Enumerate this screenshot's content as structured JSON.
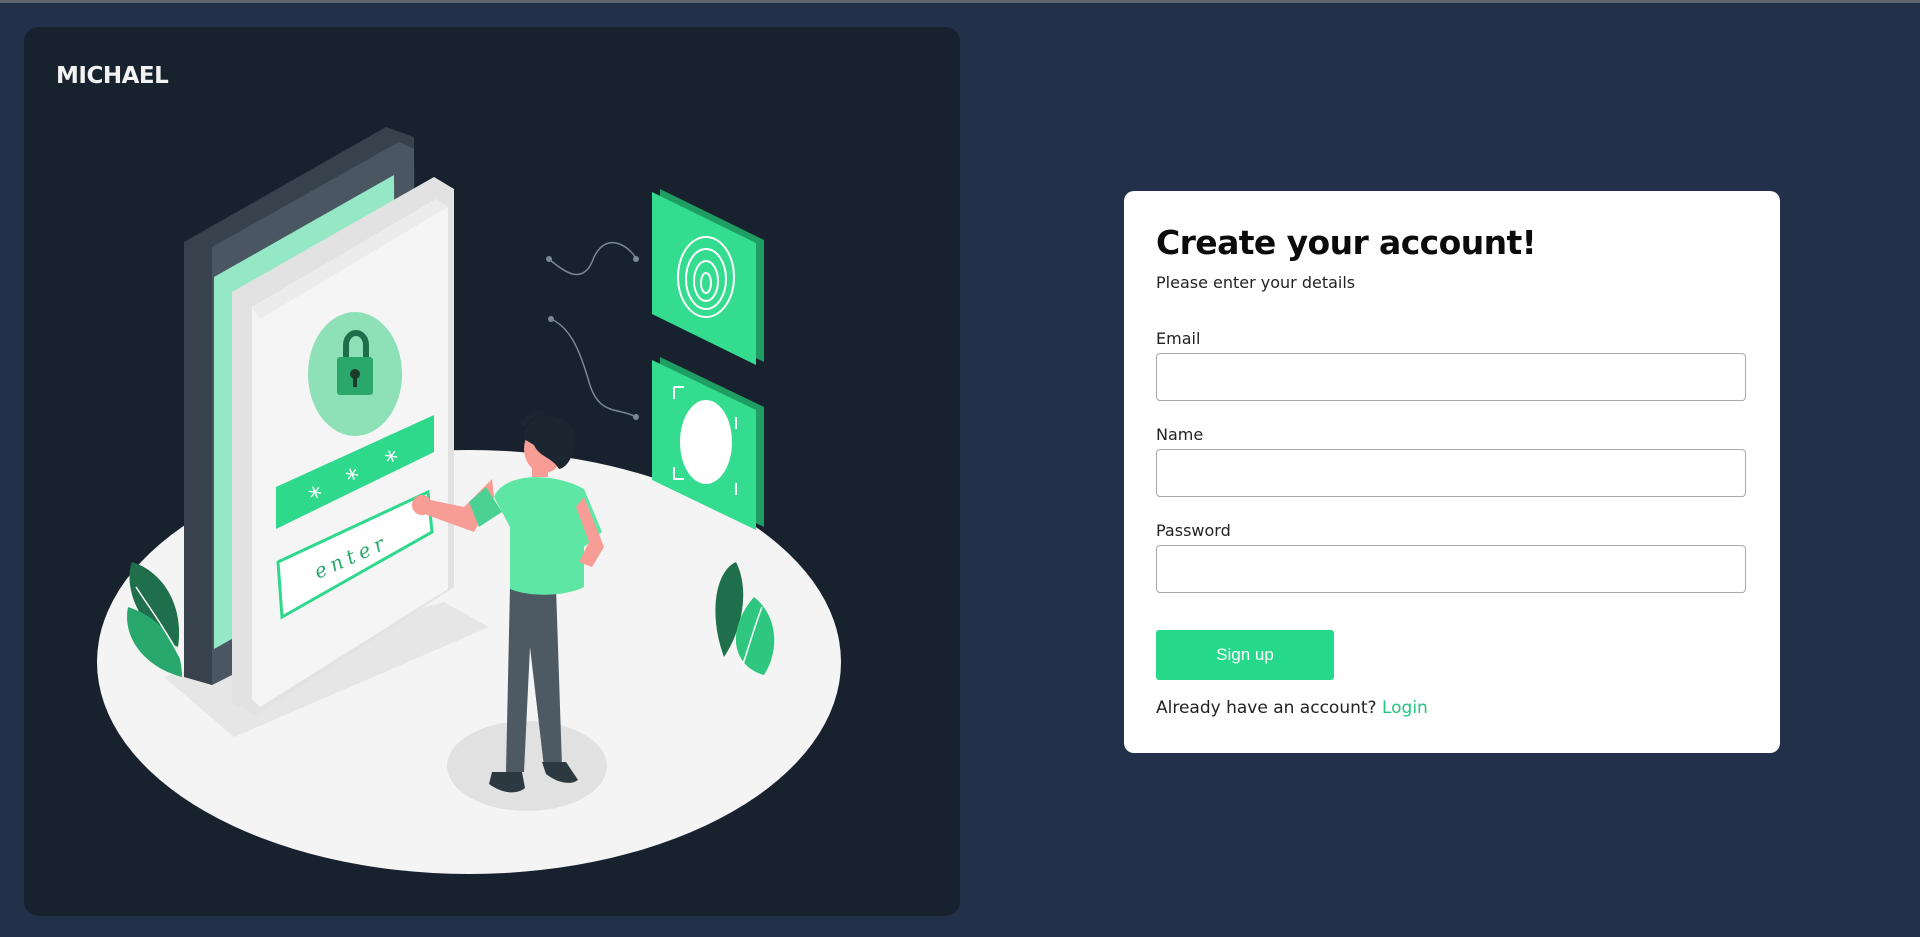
{
  "brand": {
    "name": "MICHAEL"
  },
  "illustration": {
    "icon": "login-security-illustration",
    "password_mask": [
      "*",
      "*",
      "*"
    ],
    "button_text": "enter"
  },
  "form": {
    "title": "Create your account!",
    "subtitle": "Please enter your details",
    "fields": [
      {
        "label": "Email",
        "value": "",
        "placeholder": ""
      },
      {
        "label": "Name",
        "value": "",
        "placeholder": ""
      },
      {
        "label": "Password",
        "value": "",
        "placeholder": ""
      }
    ],
    "submit_label": "Sign up",
    "login_prompt": "Already have an account?",
    "login_link": "Login"
  },
  "colors": {
    "page_background": "#22304a",
    "panel_background": "#18222f",
    "accent": "#26d98a",
    "link": "#24c47e"
  }
}
